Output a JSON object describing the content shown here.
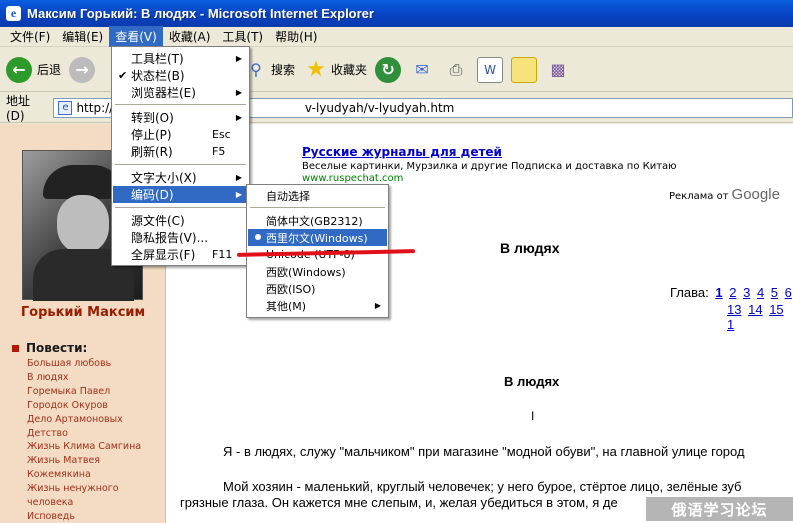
{
  "window": {
    "title": "Максим Горький: В людях - Microsoft Internet Explorer"
  },
  "menubar": {
    "items": [
      {
        "label": "文件(F)"
      },
      {
        "label": "编辑(E)"
      },
      {
        "label": "查看(V)"
      },
      {
        "label": "收藏(A)"
      },
      {
        "label": "工具(T)"
      },
      {
        "label": "帮助(H)"
      }
    ]
  },
  "toolbar": {
    "back_label": "后退",
    "search_label": "搜索",
    "favorites_label": "收藏夹"
  },
  "address": {
    "label": "地址(D)",
    "url_left": "http://g",
    "url_right": "v-lyudyah/v-lyudyah.htm"
  },
  "view_menu": {
    "items": [
      {
        "label": "工具栏(T)"
      },
      {
        "label": "状态栏(B)"
      },
      {
        "label": "浏览器栏(E)"
      },
      {
        "label": "转到(O)"
      },
      {
        "label": "停止(P)",
        "shortcut": "Esc"
      },
      {
        "label": "刷新(R)",
        "shortcut": "F5"
      },
      {
        "label": "文字大小(X)"
      },
      {
        "label": "编码(D)"
      },
      {
        "label": "源文件(C)"
      },
      {
        "label": "隐私报告(V)..."
      },
      {
        "label": "全屏显示(F)",
        "shortcut": "F11"
      }
    ]
  },
  "encoding_menu": {
    "items": [
      {
        "label": "自动选择"
      },
      {
        "label": "简体中文(GB2312)"
      },
      {
        "label": "西里尔文(Windows)"
      },
      {
        "label": "Unicode (UTF-8)"
      },
      {
        "label": "西欧(Windows)"
      },
      {
        "label": "西欧(ISO)"
      },
      {
        "label": "其他(M)"
      }
    ]
  },
  "sidebar": {
    "author": "Горький Максим",
    "stories_heading": "Повести:",
    "stories": [
      "Большая любовь",
      "В людях",
      "Горемыка Павел",
      "Городок Окуров",
      "Дело Артамоновых",
      "Детство",
      "Жизнь Клима Самгина",
      "Жизнь Матвея",
      "Кожемякина",
      "Жизнь ненужного",
      "человека",
      "Исповедь"
    ]
  },
  "ad": {
    "title": "Русские журналы для детей",
    "text": "Веселые картинки, Мурзилка и другие Подписка и доставка по Китаю",
    "url": "www.ruspechat.com",
    "google_prefix": "Реклама от",
    "google_brand": "Google"
  },
  "main": {
    "heading": "В людях",
    "chapters_label": "Глава:",
    "chapters_row1": [
      "1",
      "2",
      "3",
      "4",
      "5",
      "6"
    ],
    "chapters_row2": [
      "13",
      "14",
      "15",
      "1"
    ],
    "heading2": "В людях",
    "roman": "I",
    "para1": "Я - в людях, служу \"мальчиком\" при магазине \"модной обуви\", на главной улице город",
    "para2a": "Мой хозяин - маленький, круглый человечек; у него бурое, стёртое лицо, зелёные зуб",
    "para2b": "грязные глаза. Он кажется мне слепым, и, желая убедиться в этом, я де"
  },
  "watermark": {
    "text": "俄语学习论坛"
  }
}
